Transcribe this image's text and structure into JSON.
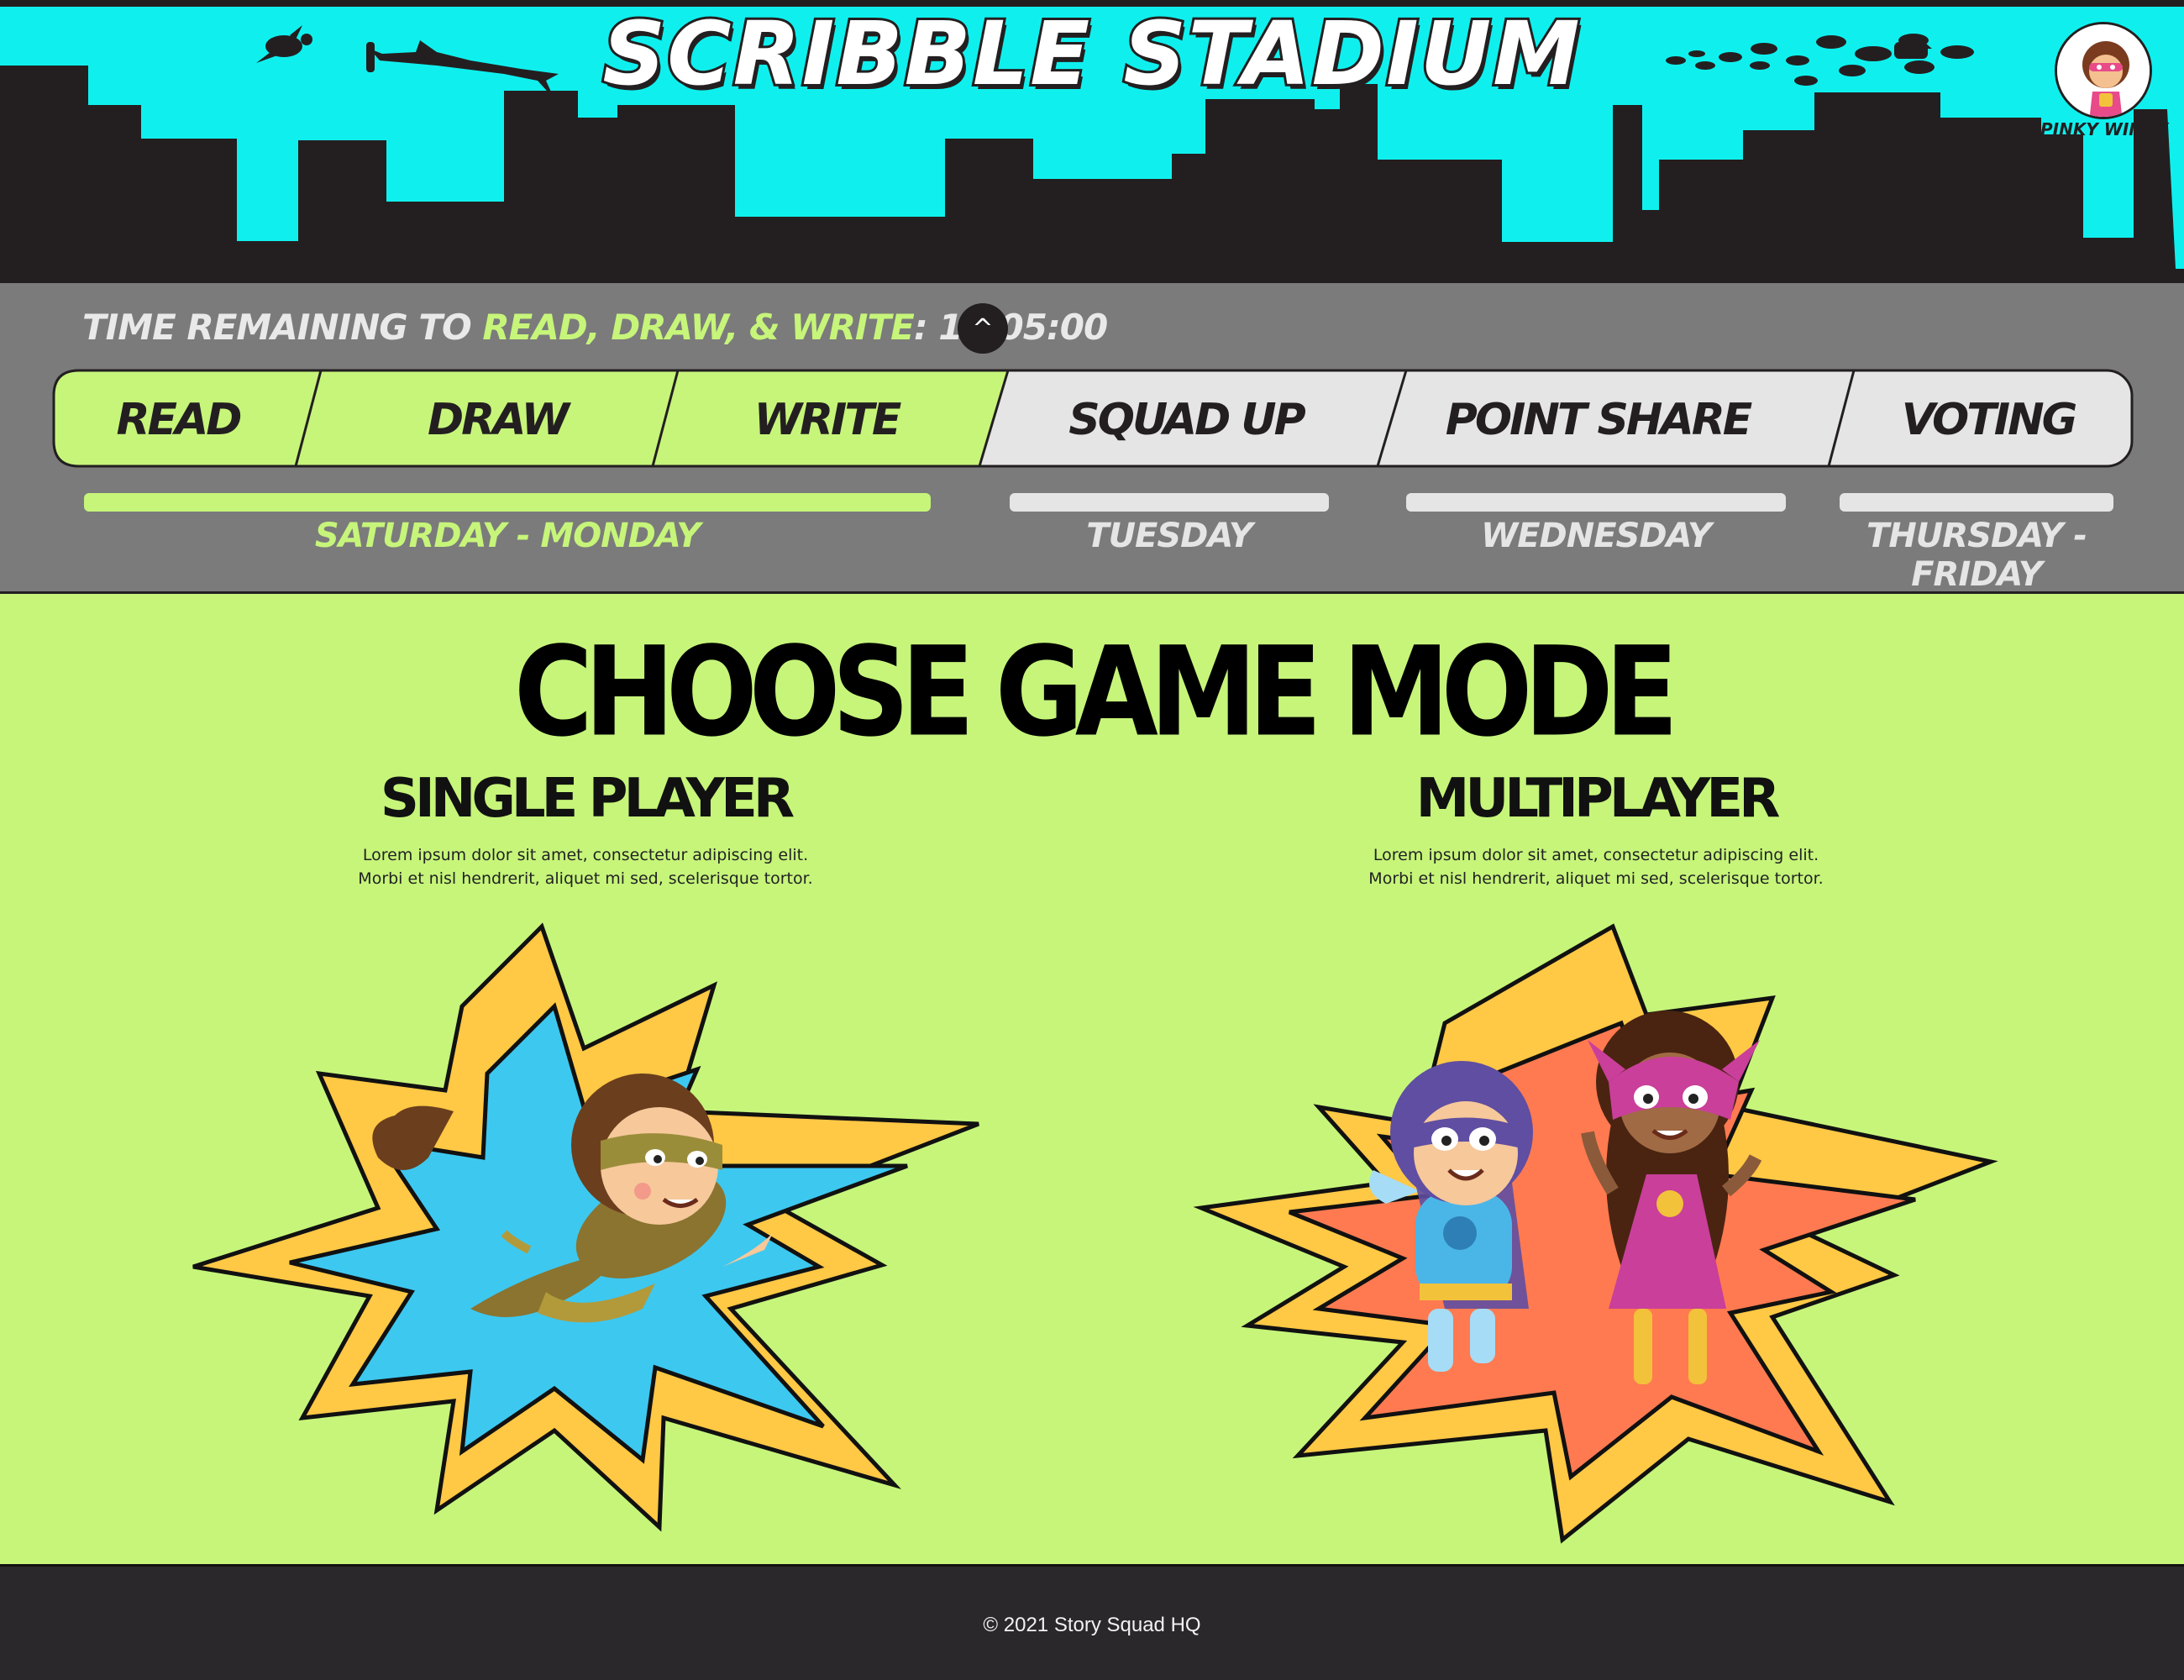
{
  "header": {
    "title": "SCRIBBLE STADIUM",
    "user_name": "PINKY WINKY",
    "sky_color": "#0ff0ee",
    "skyline_color": "#231f20"
  },
  "progress": {
    "timer_prefix": "TIME REMAINING TO ",
    "timer_highlight": "READ, DRAW, & WRITE",
    "timer_separator": ": ",
    "timer_value": "10:05:00",
    "collapse_icon": "^",
    "steps": [
      {
        "label": "READ",
        "active": true
      },
      {
        "label": "DRAW",
        "active": true
      },
      {
        "label": "WRITE",
        "active": true
      },
      {
        "label": "SQUAD UP",
        "active": false
      },
      {
        "label": "POINT SHARE",
        "active": false
      },
      {
        "label": "VOTING",
        "active": false
      }
    ],
    "phases": [
      {
        "days": "SATURDAY - MONDAY",
        "progress": 1.0,
        "active": true
      },
      {
        "days": "TUESDAY",
        "progress": 0,
        "active": false
      },
      {
        "days": "WEDNESDAY",
        "progress": 0,
        "active": false
      },
      {
        "days": "THURSDAY - FRIDAY",
        "progress": 0,
        "active": false
      }
    ],
    "active_color": "#c6f57a",
    "inactive_color": "#e5e5e5"
  },
  "main": {
    "title": "CHOOSE GAME MODE",
    "modes": [
      {
        "title": "SINGLE PLAYER",
        "desc_line1": "Lorem ipsum dolor sit amet, consectetur adipiscing elit.",
        "desc_line2": "Morbi et nisl hendrerit, aliquet mi sed, scelerisque tortor.",
        "burst_color": "#3dc8f0"
      },
      {
        "title": "MULTIPLAYER",
        "desc_line1": "Lorem ipsum dolor sit amet, consectetur adipiscing elit.",
        "desc_line2": "Morbi et nisl hendrerit, aliquet mi sed, scelerisque tortor.",
        "burst_color": "#ff7a50"
      }
    ]
  },
  "footer": {
    "copyright": "© 2021 Story Squad HQ"
  }
}
